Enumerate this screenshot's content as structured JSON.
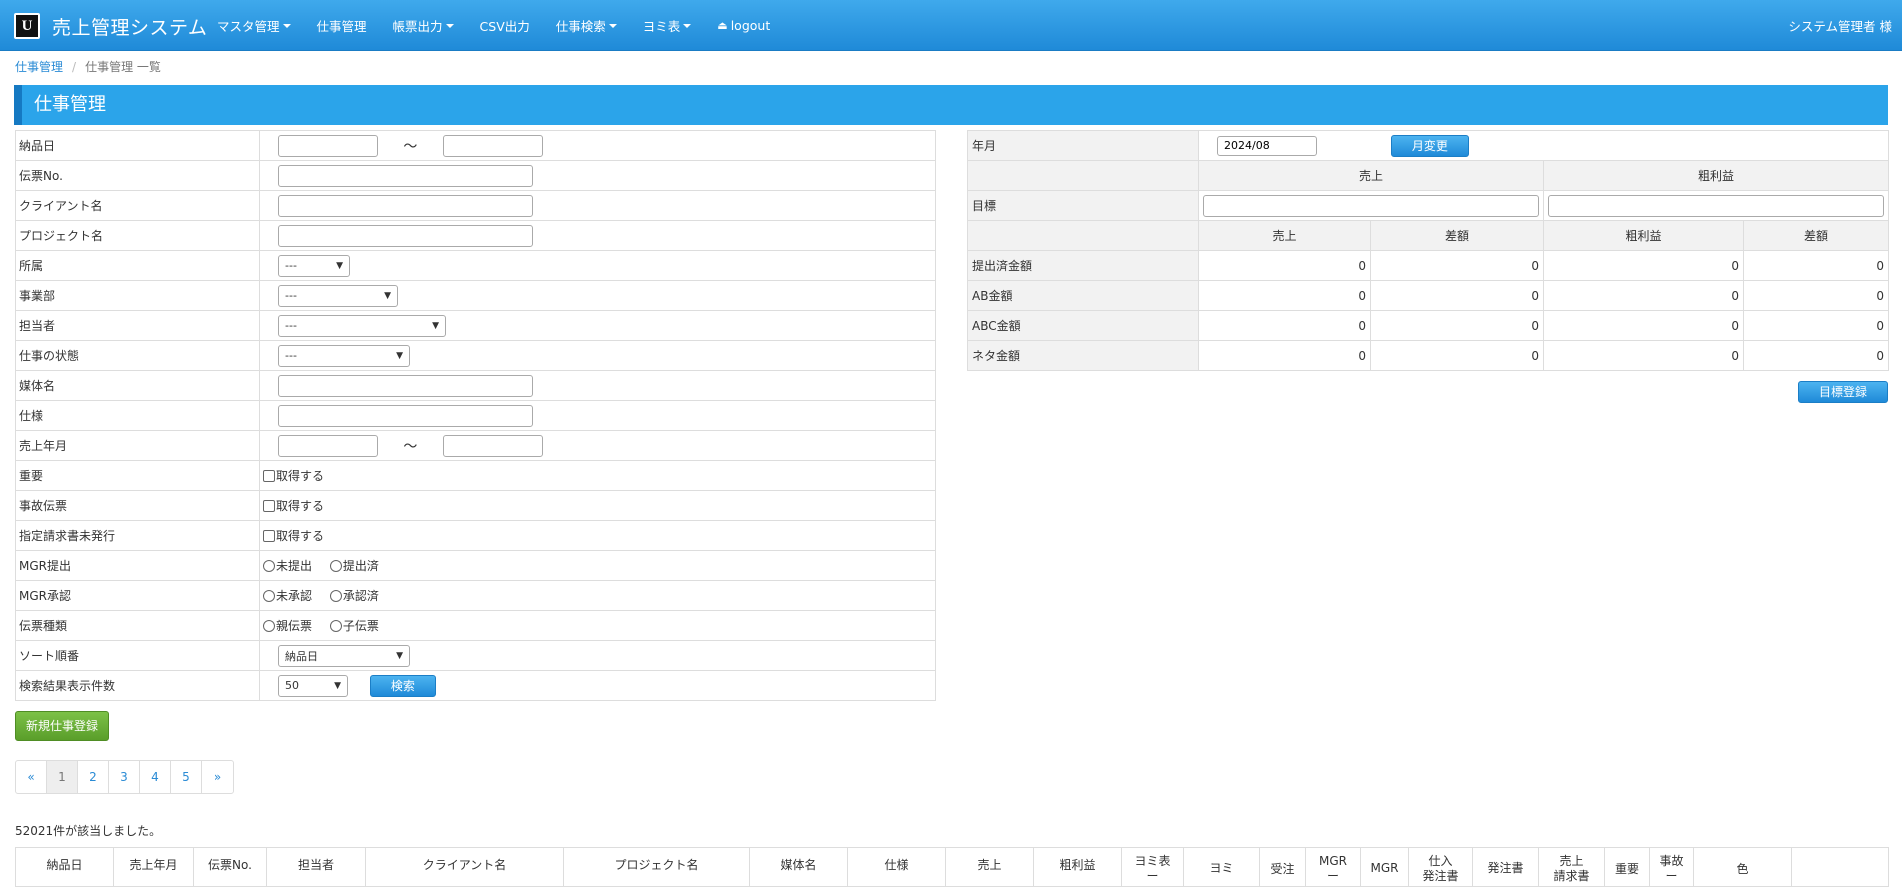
{
  "navbar": {
    "logo": "U",
    "title": "売上管理システム",
    "menu": [
      {
        "label": "マスタ管理",
        "dropdown": true
      },
      {
        "label": "仕事管理",
        "dropdown": false
      },
      {
        "label": "帳票出力",
        "dropdown": true
      },
      {
        "label": "CSV出力",
        "dropdown": false
      },
      {
        "label": "仕事検索",
        "dropdown": true
      },
      {
        "label": "ヨミ表",
        "dropdown": true
      },
      {
        "label": "logout",
        "dropdown": false,
        "icon": "eject-icon"
      }
    ],
    "user": "システム管理者 様"
  },
  "breadcrumb": {
    "link": "仕事管理",
    "separator": "/",
    "current": "仕事管理 一覧"
  },
  "page_title": "仕事管理",
  "search_form": {
    "delivery_date": {
      "label": "納品日",
      "from": "",
      "to": "",
      "tilde": "〜"
    },
    "slip_no": {
      "label": "伝票No.",
      "value": ""
    },
    "client_name": {
      "label": "クライアント名",
      "value": ""
    },
    "project_name": {
      "label": "プロジェクト名",
      "value": ""
    },
    "affiliation": {
      "label": "所属",
      "selected": "---"
    },
    "division": {
      "label": "事業部",
      "selected": "---"
    },
    "person": {
      "label": "担当者",
      "selected": "---"
    },
    "job_status": {
      "label": "仕事の状態",
      "selected": "---"
    },
    "media_name": {
      "label": "媒体名",
      "value": ""
    },
    "spec": {
      "label": "仕様",
      "value": ""
    },
    "sales_month": {
      "label": "売上年月",
      "from": "",
      "to": "",
      "tilde": "〜"
    },
    "important": {
      "label": "重要",
      "option": "取得する"
    },
    "accident_slip": {
      "label": "事故伝票",
      "option": "取得する"
    },
    "invoice_unissued": {
      "label": "指定請求書未発行",
      "option": "取得する"
    },
    "mgr_submit": {
      "label": "MGR提出",
      "options": [
        "未提出",
        "提出済"
      ]
    },
    "mgr_approve": {
      "label": "MGR承認",
      "options": [
        "未承認",
        "承認済"
      ]
    },
    "slip_type": {
      "label": "伝票種類",
      "options": [
        "親伝票",
        "子伝票"
      ]
    },
    "sort_order": {
      "label": "ソート順番",
      "selected": "納品日"
    },
    "result_count": {
      "label": "検索結果表示件数",
      "selected": "50"
    },
    "search_button": "検索"
  },
  "new_job_button": "新規仕事登録",
  "targets": {
    "month_label": "年月",
    "month_value": "2024/08",
    "change_month_button": "月変更",
    "group_sales": "売上",
    "group_profit": "粗利益",
    "goal_label": "目標",
    "sub_headers": [
      "売上",
      "差額",
      "粗利益",
      "差額"
    ],
    "rows": [
      {
        "label": "提出済金額",
        "values": [
          "0",
          "0",
          "0",
          "0"
        ]
      },
      {
        "label": "AB金額",
        "values": [
          "0",
          "0",
          "0",
          "0"
        ]
      },
      {
        "label": "ABC金額",
        "values": [
          "0",
          "0",
          "0",
          "0"
        ]
      },
      {
        "label": "ネタ金額",
        "values": [
          "0",
          "0",
          "0",
          "0"
        ]
      }
    ],
    "goal_register_button": "目標登録"
  },
  "pagination": {
    "prev": "«",
    "pages": [
      "1",
      "2",
      "3",
      "4",
      "5"
    ],
    "next": "»",
    "active": "1"
  },
  "result_text": "52021件が該当しました。",
  "result_columns": [
    {
      "l1": "納品日",
      "l2": ""
    },
    {
      "l1": "売上年月",
      "l2": ""
    },
    {
      "l1": "伝票No.",
      "l2": ""
    },
    {
      "l1": "担当者",
      "l2": ""
    },
    {
      "l1": "クライアント名",
      "l2": ""
    },
    {
      "l1": "プロジェクト名",
      "l2": ""
    },
    {
      "l1": "媒体名",
      "l2": ""
    },
    {
      "l1": "仕様",
      "l2": ""
    },
    {
      "l1": "売上",
      "l2": ""
    },
    {
      "l1": "粗利益",
      "l2": ""
    },
    {
      "l1": "ヨミ表",
      "l2": "ー"
    },
    {
      "l1": "ヨミ",
      "l2": ""
    },
    {
      "l1": "受注",
      "l2": ""
    },
    {
      "l1": "MGR",
      "l2": "ー"
    },
    {
      "l1": "MGR",
      "l2": ""
    },
    {
      "l1": "仕入",
      "l2": "発注書"
    },
    {
      "l1": "発注書",
      "l2": ""
    },
    {
      "l1": "売上",
      "l2": "請求書"
    },
    {
      "l1": "重要",
      "l2": ""
    },
    {
      "l1": "事故",
      "l2": "ー"
    },
    {
      "l1": "色",
      "l2": ""
    },
    {
      "l1": "",
      "l2": ""
    }
  ]
}
